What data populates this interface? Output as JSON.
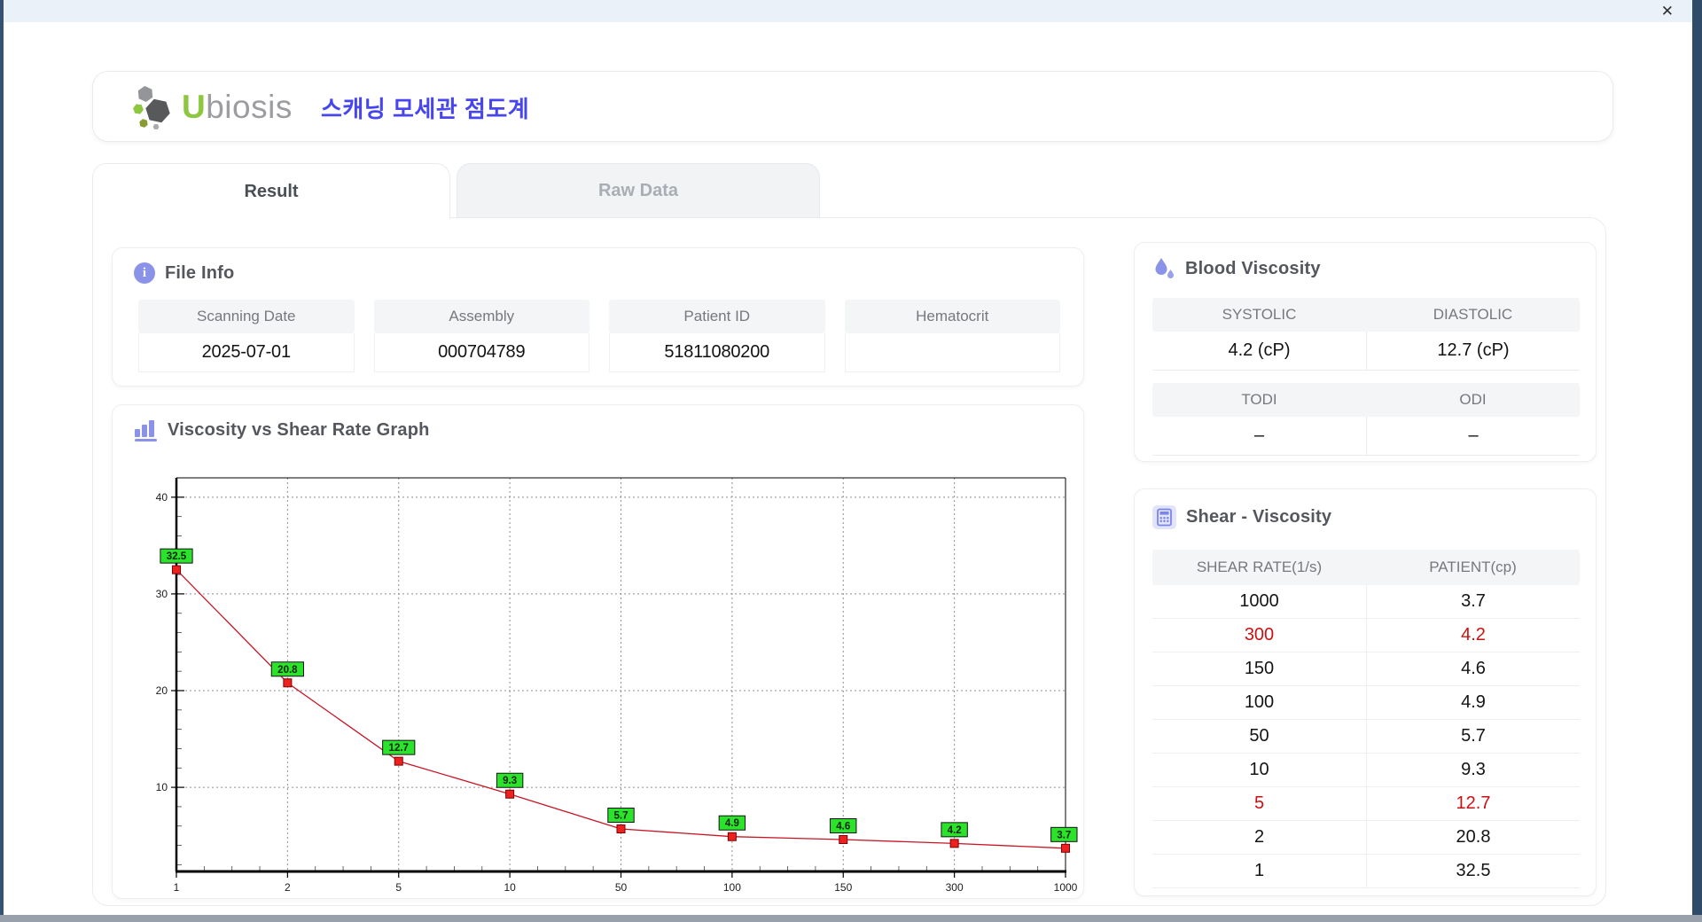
{
  "window": {
    "close_label": "✕"
  },
  "icons": {
    "info_letter": "i"
  },
  "header": {
    "brand_u": "U",
    "brand_rest": "biosis",
    "title_ko": "스캐닝 모세관 점도계"
  },
  "tabs": [
    {
      "label": "Result",
      "active": true
    },
    {
      "label": "Raw Data",
      "active": false
    }
  ],
  "file_info": {
    "section_title": "File Info",
    "fields": [
      {
        "label": "Scanning Date",
        "value": "2025-07-01"
      },
      {
        "label": "Assembly",
        "value": "000704789"
      },
      {
        "label": "Patient ID",
        "value": "51811080200"
      },
      {
        "label": "Hematocrit",
        "value": ""
      }
    ]
  },
  "blood_viscosity": {
    "section_title": "Blood Viscosity",
    "groups": [
      {
        "labels": [
          "SYSTOLIC",
          "DIASTOLIC"
        ],
        "values": [
          "4.2 (cP)",
          "12.7 (cP)"
        ]
      },
      {
        "labels": [
          "TODI",
          "ODI"
        ],
        "values": [
          "–",
          "–"
        ]
      }
    ]
  },
  "graph": {
    "section_title": "Viscosity vs Shear Rate Graph"
  },
  "chart_data": {
    "type": "line",
    "title": "Viscosity vs Shear Rate Graph",
    "x_scale": "categorical",
    "categories": [
      1,
      2,
      5,
      10,
      50,
      100,
      150,
      300,
      1000
    ],
    "values": [
      32.5,
      20.8,
      12.7,
      9.3,
      5.7,
      4.9,
      4.6,
      4.2,
      3.7
    ],
    "point_labels": [
      "32.5",
      "20.8",
      "12.7",
      "9.3",
      "5.7",
      "4.9",
      "4.6",
      "4.2",
      "3.7"
    ],
    "xlabel": "",
    "ylabel": "",
    "ylim": [
      1.3,
      42
    ],
    "yticks": [
      10,
      20,
      30,
      40
    ],
    "grid": true,
    "grid_style": "dashed",
    "legend": "none",
    "line_color": "#c81425",
    "marker_color": "#ee2020",
    "marker_edge": "#7d0000",
    "label_bg": "#2be32b",
    "label_border": "#111111"
  },
  "shear_table": {
    "section_title": "Shear - Viscosity",
    "columns": [
      "SHEAR RATE(1/s)",
      "PATIENT(cp)"
    ],
    "rows": [
      {
        "rate": "1000",
        "patient": "3.7",
        "highlight": false
      },
      {
        "rate": "300",
        "patient": "4.2",
        "highlight": true
      },
      {
        "rate": "150",
        "patient": "4.6",
        "highlight": false
      },
      {
        "rate": "100",
        "patient": "4.9",
        "highlight": false
      },
      {
        "rate": "50",
        "patient": "5.7",
        "highlight": false
      },
      {
        "rate": "10",
        "patient": "9.3",
        "highlight": false
      },
      {
        "rate": "5",
        "patient": "12.7",
        "highlight": true
      },
      {
        "rate": "2",
        "patient": "20.8",
        "highlight": false
      },
      {
        "rate": "1",
        "patient": "32.5",
        "highlight": false
      }
    ]
  },
  "colors": {
    "accent_periwinkle": "#8a93e8",
    "title_blue": "#4645ee",
    "brand_green": "#8dc63f",
    "highlight_red": "#cc1111",
    "header_gray_bg": "#f4f5f7"
  }
}
